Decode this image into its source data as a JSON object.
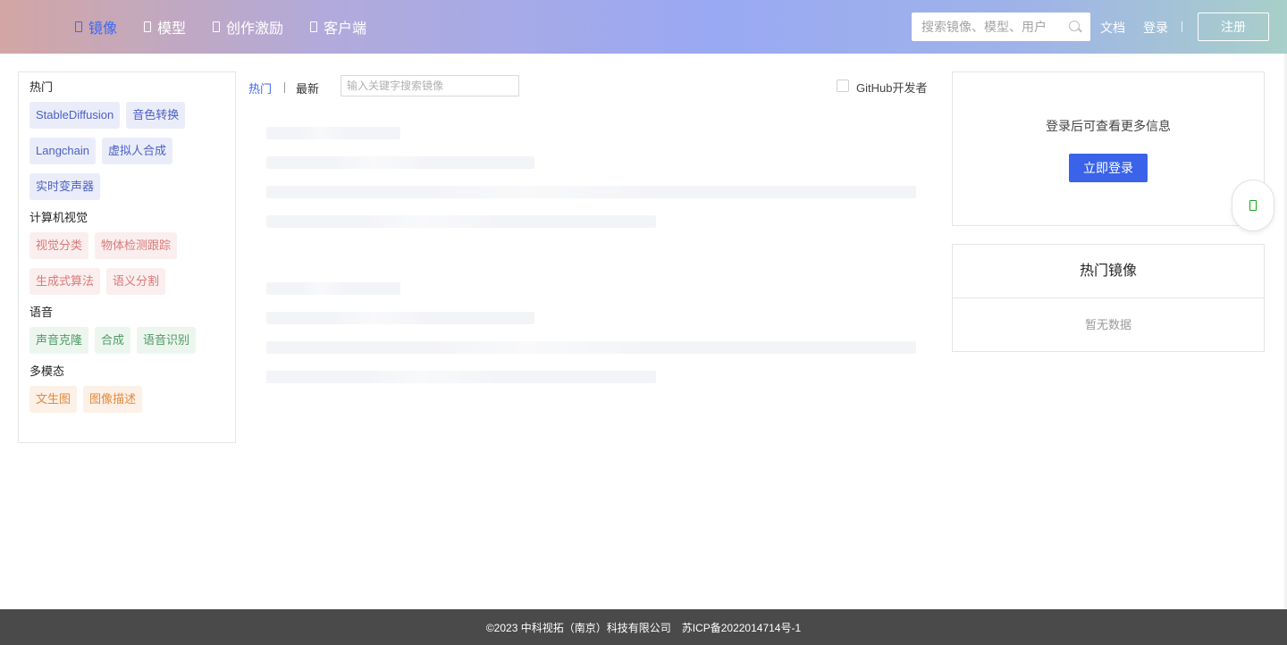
{
  "header": {
    "nav": [
      {
        "label": "镜像",
        "active": true
      },
      {
        "label": "模型",
        "active": false
      },
      {
        "label": "创作激励",
        "active": false
      },
      {
        "label": "客户端",
        "active": false
      }
    ],
    "search_placeholder": "搜索镜像、模型、用户",
    "docs_label": "文档",
    "login_label": "登录",
    "register_label": "注册"
  },
  "sidebar": {
    "categories": [
      {
        "title": "热门",
        "color": "blue",
        "tags": [
          "StableDiffusion",
          "音色转换",
          "Langchain",
          "虚拟人合成",
          "实时变声器"
        ]
      },
      {
        "title": "计算机视觉",
        "color": "red",
        "tags": [
          "视觉分类",
          "物体检测跟踪",
          "生成式算法",
          "语义分割"
        ]
      },
      {
        "title": "语音",
        "color": "green",
        "tags": [
          "声音克隆",
          "合成",
          "语音识别"
        ]
      },
      {
        "title": "多模态",
        "color": "orange",
        "tags": [
          "文生图",
          "图像描述"
        ]
      }
    ]
  },
  "main": {
    "tab_hot": "热门",
    "tab_latest": "最新",
    "keyword_placeholder": "输入关键字搜索镜像",
    "github_label": "GitHub开发者"
  },
  "login_card": {
    "tip": "登录后可查看更多信息",
    "button": "立即登录"
  },
  "hot_images": {
    "title": "热门镜像",
    "empty": "暂无数据"
  },
  "footer": {
    "copyright": "©2023 中科视拓（南京）科技有限公司",
    "icp": "苏ICP备2022014714号-1"
  }
}
